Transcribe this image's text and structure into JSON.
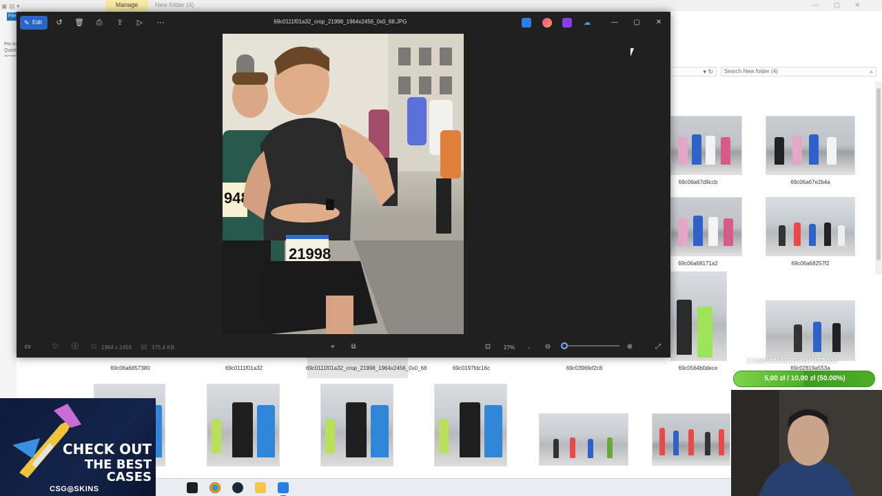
{
  "explorer": {
    "quick_access_text": "Pin to Quick access",
    "ribbon_file_tab": "File",
    "manage_tab": "Manage",
    "folder_title": "New folder (4)",
    "address_tail": "",
    "search_placeholder": "Search New folder (4)",
    "thumbnails_right": [
      {
        "name": "69c06a67d9ccb"
      },
      {
        "name": "69c06a67e2b4a"
      },
      {
        "name": "69c06a68171a2"
      },
      {
        "name": "69c06a68257f2"
      },
      {
        "name": "69c0564b0dece"
      },
      {
        "name": "69c02819a553a"
      }
    ],
    "thumbnails_row": [
      {
        "name": "69c06a6857380"
      },
      {
        "name": "69c0111f01a32"
      },
      {
        "name": "69c0111f01a32_crop_21998_1964x2456_0x0_68",
        "selected": true
      },
      {
        "name": "69c0197fdc16c"
      },
      {
        "name": "69c0396fef2c8"
      }
    ]
  },
  "viewer": {
    "edit_label": "Edit",
    "file_title": "69c0111f01a32_crop_21998_1964x2456_0x0_68.JPG",
    "dimensions": "1964 x 2456",
    "file_size": "375.4 KB",
    "zoom": "27%",
    "zoom_fraction": 0.0,
    "bib_number": "21998"
  },
  "overlays": {
    "ad_line1": "CHECK OUT",
    "ad_line2": "THE BEST",
    "ad_line3": "CASES",
    "ad_brand": "CSG◎SKINS",
    "donation_watermark": "CANNONAIRDROP.IT2000",
    "donation_text": "5,00 zł / 10,00 zł (50.00%)",
    "donation_progress": 0.5
  },
  "colors": {
    "viewer_bg": "#202020",
    "accent": "#2a66c8",
    "manage_tab": "#f8eca4",
    "donation_green": "#4cae27"
  }
}
